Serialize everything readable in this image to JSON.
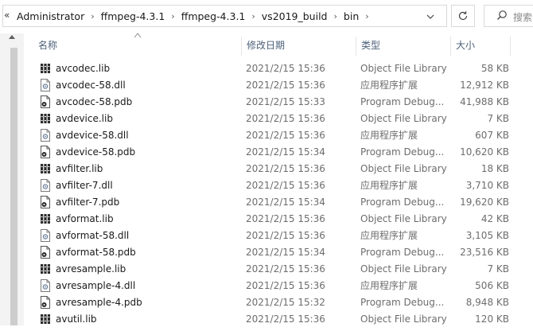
{
  "address": {
    "overflow": "«",
    "breadcrumbs": [
      "Administrator",
      "ffmpeg-4.3.1",
      "ffmpeg-4.3.1",
      "vs2019_build",
      "bin"
    ],
    "refresh_icon": "refresh-icon",
    "search_placeholder": "搜索"
  },
  "columns": {
    "name": "名称",
    "date": "修改日期",
    "type": "类型",
    "size": "大小"
  },
  "files": [
    {
      "name": "avcodec.lib",
      "icon": "lib-file-icon",
      "date": "2021/2/15 15:36",
      "type": "Object File Library",
      "size": "58 KB"
    },
    {
      "name": "avcodec-58.dll",
      "icon": "dll-file-icon",
      "date": "2021/2/15 15:36",
      "type": "应用程序扩展",
      "size": "12,912 KB"
    },
    {
      "name": "avcodec-58.pdb",
      "icon": "pdb-file-icon",
      "date": "2021/2/15 15:33",
      "type": "Program Debug...",
      "size": "41,988 KB"
    },
    {
      "name": "avdevice.lib",
      "icon": "lib-file-icon",
      "date": "2021/2/15 15:36",
      "type": "Object File Library",
      "size": "7 KB"
    },
    {
      "name": "avdevice-58.dll",
      "icon": "dll-file-icon",
      "date": "2021/2/15 15:36",
      "type": "应用程序扩展",
      "size": "607 KB"
    },
    {
      "name": "avdevice-58.pdb",
      "icon": "pdb-file-icon",
      "date": "2021/2/15 15:34",
      "type": "Program Debug...",
      "size": "10,620 KB"
    },
    {
      "name": "avfilter.lib",
      "icon": "lib-file-icon",
      "date": "2021/2/15 15:36",
      "type": "Object File Library",
      "size": "18 KB"
    },
    {
      "name": "avfilter-7.dll",
      "icon": "dll-file-icon",
      "date": "2021/2/15 15:36",
      "type": "应用程序扩展",
      "size": "3,710 KB"
    },
    {
      "name": "avfilter-7.pdb",
      "icon": "pdb-file-icon",
      "date": "2021/2/15 15:34",
      "type": "Program Debug...",
      "size": "19,620 KB"
    },
    {
      "name": "avformat.lib",
      "icon": "lib-file-icon",
      "date": "2021/2/15 15:36",
      "type": "Object File Library",
      "size": "42 KB"
    },
    {
      "name": "avformat-58.dll",
      "icon": "dll-file-icon",
      "date": "2021/2/15 15:36",
      "type": "应用程序扩展",
      "size": "3,105 KB"
    },
    {
      "name": "avformat-58.pdb",
      "icon": "pdb-file-icon",
      "date": "2021/2/15 15:34",
      "type": "Program Debug...",
      "size": "23,516 KB"
    },
    {
      "name": "avresample.lib",
      "icon": "lib-file-icon",
      "date": "2021/2/15 15:36",
      "type": "Object File Library",
      "size": "7 KB"
    },
    {
      "name": "avresample-4.dll",
      "icon": "dll-file-icon",
      "date": "2021/2/15 15:36",
      "type": "应用程序扩展",
      "size": "506 KB"
    },
    {
      "name": "avresample-4.pdb",
      "icon": "pdb-file-icon",
      "date": "2021/2/15 15:32",
      "type": "Program Debug...",
      "size": "8,948 KB"
    },
    {
      "name": "avutil.lib",
      "icon": "lib-file-icon",
      "date": "2021/2/15 15:36",
      "type": "Object File Library",
      "size": "120 KB"
    }
  ]
}
